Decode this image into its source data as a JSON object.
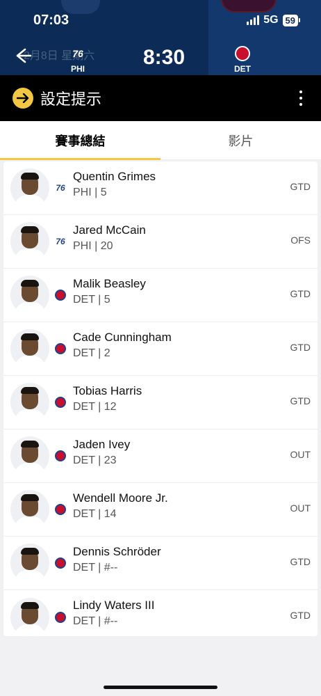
{
  "status_bar": {
    "time": "07:03",
    "network": "5G",
    "battery": "59"
  },
  "header": {
    "date": "2月8日 星期六",
    "home_team": "PHI",
    "away_team": "DET",
    "home_logo_text": "76",
    "game_time": "8:30"
  },
  "alert": {
    "label": "設定提示"
  },
  "tabs": [
    {
      "label": "賽事總結",
      "active": true
    },
    {
      "label": "影片",
      "active": false
    }
  ],
  "players": [
    {
      "name": "Quentin Grimes",
      "team_line": "PHI | 5",
      "team": "PHI",
      "status": "GTD"
    },
    {
      "name": "Jared McCain",
      "team_line": "PHI | 20",
      "team": "PHI",
      "status": "OFS"
    },
    {
      "name": "Malik Beasley",
      "team_line": "DET | 5",
      "team": "DET",
      "status": "GTD"
    },
    {
      "name": "Cade Cunningham",
      "team_line": "DET | 2",
      "team": "DET",
      "status": "GTD"
    },
    {
      "name": "Tobias Harris",
      "team_line": "DET | 12",
      "team": "DET",
      "status": "GTD"
    },
    {
      "name": "Jaden Ivey",
      "team_line": "DET | 23",
      "team": "DET",
      "status": "OUT"
    },
    {
      "name": "Wendell Moore Jr.",
      "team_line": "DET | 14",
      "team": "DET",
      "status": "OUT"
    },
    {
      "name": "Dennis Schröder",
      "team_line": "DET | #--",
      "team": "DET",
      "status": "GTD"
    },
    {
      "name": "Lindy Waters III",
      "team_line": "DET | #--",
      "team": "DET",
      "status": "GTD"
    }
  ],
  "colors": {
    "header_bg": "#0c2b57",
    "accent": "#f3c743",
    "det_red": "#c8102e",
    "phi_blue": "#1d428a"
  }
}
